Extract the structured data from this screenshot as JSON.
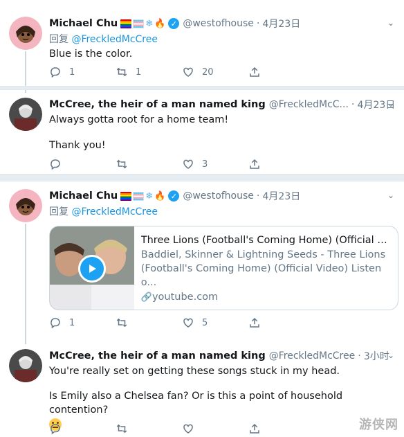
{
  "tweets": [
    {
      "name": "Michael Chu",
      "handle": "@westofhouse",
      "time": "4月23日",
      "reply_label": "回复",
      "reply_to": "@FreckledMcCree",
      "text": "Blue is the color.",
      "replies": "1",
      "retweets": "1",
      "likes": "20"
    },
    {
      "name": "McCree, the heir of a man named king",
      "handle": "@FreckledMcC...",
      "time": "4月23日",
      "text_line1": "Always gotta root for a home team!",
      "text_line2": "Thank you!",
      "replies": "",
      "retweets": "",
      "likes": "3"
    },
    {
      "name": "Michael Chu",
      "handle": "@westofhouse",
      "time": "4月23日",
      "reply_label": "回复",
      "reply_to": "@FreckledMcCree",
      "card": {
        "title": "Three Lions (Football's Coming Home) (Official Vi...",
        "description": "Baddiel, Skinner & Lightning Seeds - Three Lions (Football's Coming Home) (Official Video) Listen o...",
        "domain": "youtube.com"
      },
      "replies": "1",
      "retweets": "",
      "likes": "5"
    },
    {
      "name": "McCree, the heir of a man named king",
      "handle": "@FreckledMcCree",
      "time": "3小时",
      "text_line1": "You're really set on getting these songs stuck in my head.",
      "text_line2": "Is Emily also a Chelsea fan? Or is this a point of household contention?",
      "replies": "",
      "retweets": "",
      "likes": ""
    }
  ],
  "separator_dot": "·",
  "watermark": "游侠网",
  "colors": {
    "link": "#1b95e0",
    "muted": "#657786",
    "verified": "#1da1f2",
    "separator": "#e6ecf0"
  },
  "icons": [
    "reply-icon",
    "retweet-icon",
    "like-icon",
    "share-icon",
    "verified-icon",
    "caret-down-icon",
    "play-icon",
    "link-icon"
  ]
}
